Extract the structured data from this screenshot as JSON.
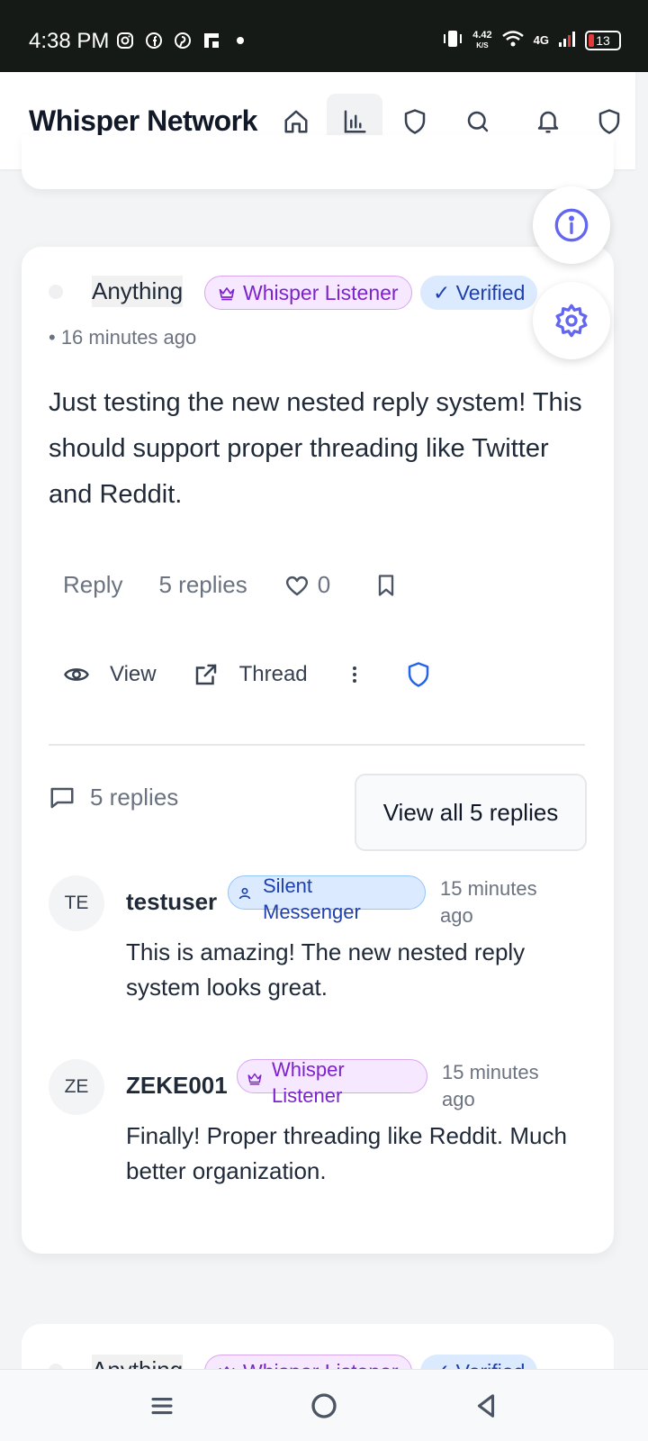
{
  "status_bar": {
    "time": "4:38 PM",
    "speed_value": "4.42",
    "speed_unit": "K/S",
    "network": "4G",
    "battery": "13"
  },
  "header": {
    "title": "Whisper Network"
  },
  "post": {
    "author": "Anything",
    "badge_role": "Whisper Listener",
    "badge_verified": "✓ Verified",
    "timestamp": "• 16 minutes ago",
    "content": "Just testing the new nested reply system! This should support proper threading like Twitter and Reddit.",
    "actions": {
      "reply": "Reply",
      "replies": "5 replies",
      "likes": "0",
      "view": "View",
      "thread": "Thread"
    },
    "replies_summary": "5 replies",
    "view_all": "View all 5 replies",
    "replies": [
      {
        "initials": "TE",
        "username": "testuser",
        "badge": "Silent Messenger",
        "time": "15 minutes ago",
        "text": "This is amazing! The new nested reply system looks great."
      },
      {
        "initials": "ZE",
        "username": "ZEKE001",
        "badge": "Whisper Listener",
        "time": "15 minutes ago",
        "text": "Finally! Proper threading like Reddit. Much better organization."
      }
    ]
  },
  "next_post": {
    "author": "Anything",
    "badge_role": "Whisper Listener",
    "badge_verified": "✓ Verified"
  },
  "colors": {
    "accent_purple": "#7e22ce",
    "accent_blue": "#1e40af",
    "fab_icon": "#6366f1"
  }
}
